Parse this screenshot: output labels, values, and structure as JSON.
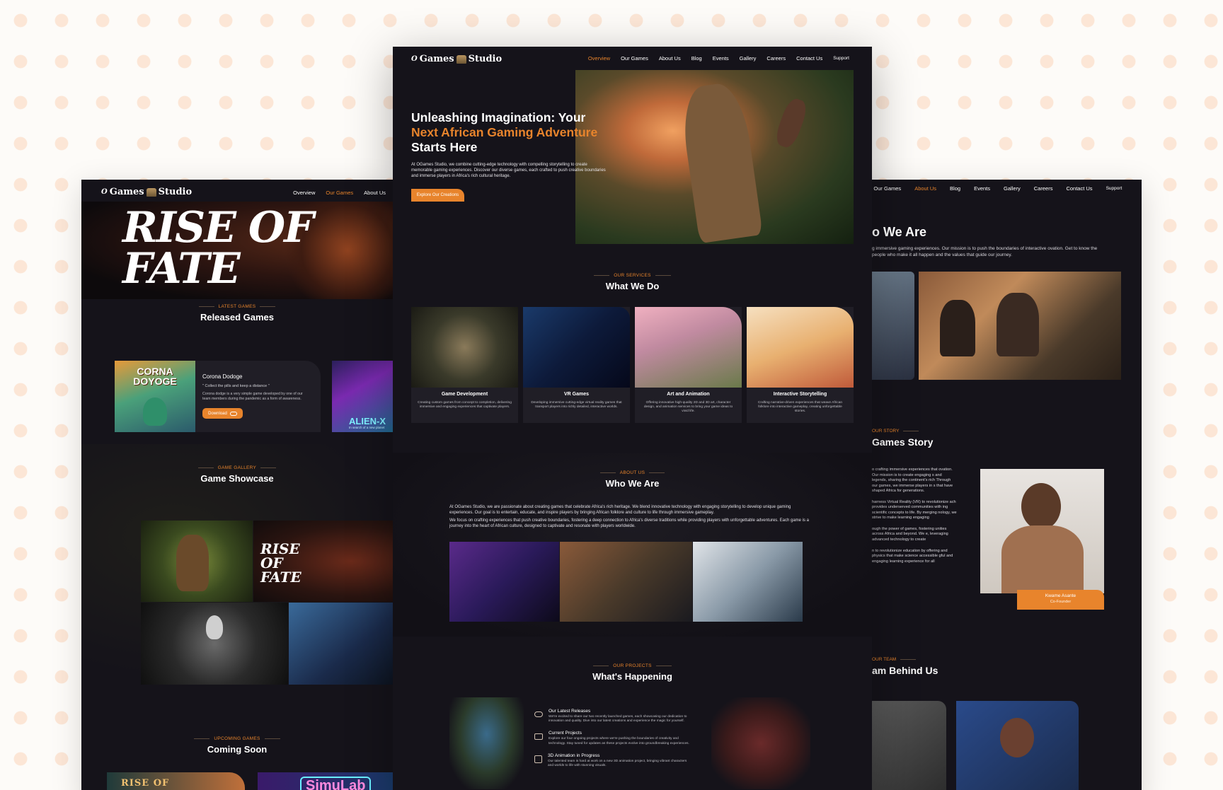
{
  "brand": {
    "logo_text": "Games",
    "logo_prefix": "O",
    "logo_suffix": "Studio"
  },
  "colors": {
    "accent": "#e8842c",
    "panel": "#15131a",
    "card": "#201e26"
  },
  "left": {
    "nav": [
      "Overview",
      "Our Games",
      "About Us"
    ],
    "hero_text": "RISE OF FATE",
    "released": {
      "eyebrow": "LATEST GAMES",
      "title": "Released Games"
    },
    "game_card": {
      "title": "Corona Dodoge",
      "quote": "\" Collect the pills and keep a distance \"",
      "description": "Corona dodge is a very simple game developed by one of our team members during the pandemic as a form of awareness.",
      "button": "Download",
      "cover_text": "CORNA DOYOGE"
    },
    "second_cover": {
      "title": "ALIEN-X",
      "subtitle": "In search of a new planet"
    },
    "gallery": {
      "eyebrow": "GAME GALLERY",
      "title": "Game Showcase",
      "tile_text": "RISE OF FATE"
    },
    "upcoming": {
      "eyebrow": "UPCOMING GAMES",
      "title": "Coming Soon",
      "card1": "RISE OF",
      "card2": "SimuLab"
    }
  },
  "center": {
    "nav": [
      "Overview",
      "Our Games",
      "About Us",
      "Blog",
      "Events",
      "Gallery",
      "Careers",
      "Contact Us",
      "Support"
    ],
    "hero": {
      "line1": "Unleashing Imagination: Your",
      "line2": "Next African Gaming Adventure",
      "line3": "Starts Here",
      "body": "At OGames Studio, we combine cutting-edge technology with compelling storytelling to create memorable gaming experiences. Discover our diverse games, each crafted to push creative boundaries and immerse players in Africa's rich cultural heritage.",
      "cta": "Explore Our Creations"
    },
    "services": {
      "eyebrow": "OUR SERVICES",
      "title": "What We Do",
      "items": [
        {
          "title": "Game Development",
          "text": "Creating custom games from concept to completion, delivering immersive and engaging experiences that captivate players."
        },
        {
          "title": "VR Games",
          "text": "Developing immersive cutting-edge virtual reality games that transport players into richly detailed, interactive worlds."
        },
        {
          "title": "Art and Animation",
          "text": "Offering innovative high-quality 2D and 3D art, character design, and animation services to bring your game ideas to vivid life."
        },
        {
          "title": "Interactive Storytelling",
          "text": "Crafting narrative-driven experiences that weave African folklore into interactive gameplay, creating unforgettable stories."
        }
      ]
    },
    "about": {
      "eyebrow": "ABOUT US",
      "title": "Who We Are",
      "p1": "At OGames Studio, we are passionate about creating games that celebrate Africa's rich heritage. We blend innovative technology with engaging storytelling to develop unique gaming experiences. Our goal is to entertain, educate, and inspire players by bringing African folklore and culture to life through immersive gameplay.",
      "p2": "We focus on crafting experiences that push creative boundaries, fostering a deep connection to Africa's diverse traditions while providing players with unforgettable adventures. Each game is a journey into the heart of African culture, designed to captivate and resonate with players worldwide."
    },
    "projects": {
      "eyebrow": "OUR PROJECTS",
      "title": "What's Happening",
      "items": [
        {
          "title": "Our Latest Releases",
          "text": "We're excited to share our two recently launched games, each showcasing our dedication to innovation and quality. Dive into our latest creations and experience the magic for yourself."
        },
        {
          "title": "Current Projects",
          "text": "Explore our four ongoing projects where we're pushing the boundaries of creativity and technology. Stay tuned for updates as these projects evolve into groundbreaking experiences."
        },
        {
          "title": "3D Animation in Progress",
          "text": "Our talented team is hard at work on a new 3D animation project, bringing vibrant characters and worlds to life with stunning visuals."
        }
      ]
    }
  },
  "right": {
    "nav": [
      "w",
      "Our Games",
      "About Us",
      "Blog",
      "Events",
      "Gallery",
      "Careers",
      "Contact Us",
      "Support"
    ],
    "who": {
      "title": "o We Are",
      "text": "g immersive gaming experiences. Our mission is to push the boundaries of interactive ovation. Get to know the people who make it all happen and the values that guide our journey."
    },
    "story": {
      "eyebrow": "OUR STORY",
      "title": "Games Story",
      "p1": "o crafting immersive experiences that ovation. Our mission is to create engaging s and legends, sharing the continent's rich Through our games, we immerse players in s that have shaped Africa for generations.",
      "p2": "harness Virtual Reality (VR) to revolutionize ach provides underserved communities with ing scientific concepts to life. By merging nology, we strive to make learning engaging",
      "p3": "ough the power of games, fostering unities across Africa and beyond. We e, leveraging advanced technology to create",
      "p4": "n to revolutionize education by offering and physics that make science accessible gful and engaging learning experience for all",
      "person_name": "Kwame Asante",
      "person_role": "Co-Founder"
    },
    "team": {
      "eyebrow": "OUR TEAM",
      "title": "am Behind Us"
    }
  }
}
